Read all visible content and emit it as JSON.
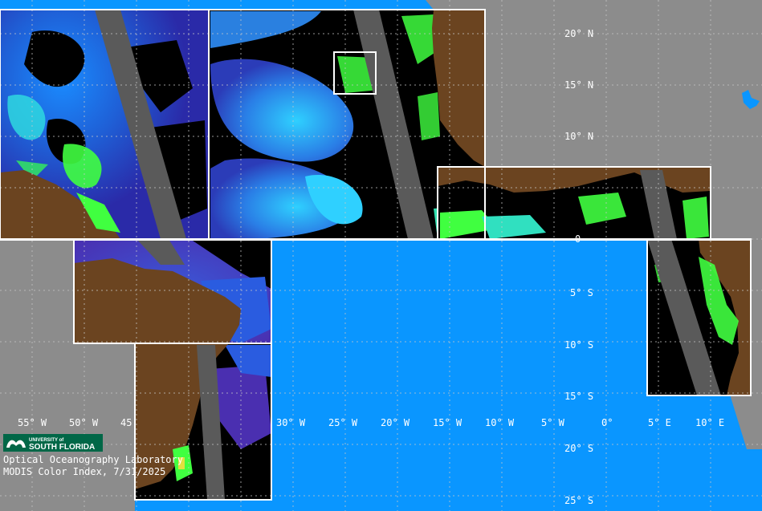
{
  "map": {
    "colors": {
      "ocean_nodata": "#0a96ff",
      "land_map": "#8c8c8c",
      "land_satellite": "#6b4420",
      "swath_gap": "#5a5a5a",
      "no_data_black": "#000000",
      "tile_border": "#ffffff",
      "grid": "#c8c8c8"
    },
    "lat_labels": [
      "20° N",
      "15° N",
      "10° N",
      "0",
      "5° S",
      "10° S",
      "15° S",
      "20° S",
      "25° S"
    ],
    "lon_labels": [
      "55° W",
      "50° W",
      "45",
      "30° W",
      "25° W",
      "20° W",
      "15° W",
      "10° W",
      "5° W",
      "0°",
      "5° E",
      "10° E"
    ]
  },
  "credit": {
    "university_top": "UNIVERSITY of",
    "university_name": "SOUTH FLORIDA",
    "lab": "Optical Oceanography Laboratory",
    "product": "MODIS Color Index, 7/31/2025"
  }
}
